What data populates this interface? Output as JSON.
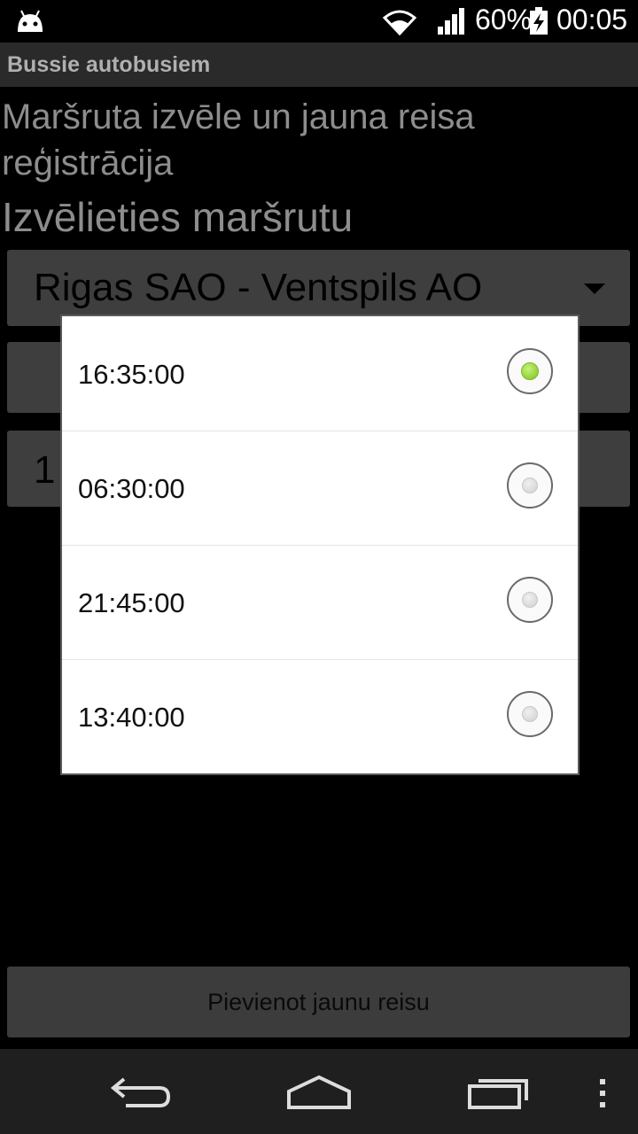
{
  "status_bar": {
    "battery_percent": "60%",
    "time": "00:05",
    "icons": [
      "android-icon",
      "wifi-icon",
      "signal-icon",
      "battery-charging-icon"
    ]
  },
  "app": {
    "title": "Bussie autobusiem"
  },
  "main": {
    "heading": "Maršruta izvēle un jauna reisa reģistrācija",
    "subheading": "Izvēlieties maršrutu",
    "route_spinner": {
      "selected": "Rigas SAO - Ventspils AO"
    },
    "partial_value": "1",
    "add_button": "Pievienot jaunu reisu"
  },
  "dialog": {
    "options": [
      {
        "label": "16:35:00",
        "checked": true
      },
      {
        "label": "06:30:00",
        "checked": false
      },
      {
        "label": "21:45:00",
        "checked": false
      },
      {
        "label": "13:40:00",
        "checked": false
      }
    ]
  },
  "navbar": {
    "icons": [
      "back-icon",
      "home-icon",
      "recent-apps-icon",
      "menu-icon"
    ]
  },
  "colors": {
    "radio_selected": "#7bc21a",
    "dialog_bg": "#ffffff"
  }
}
